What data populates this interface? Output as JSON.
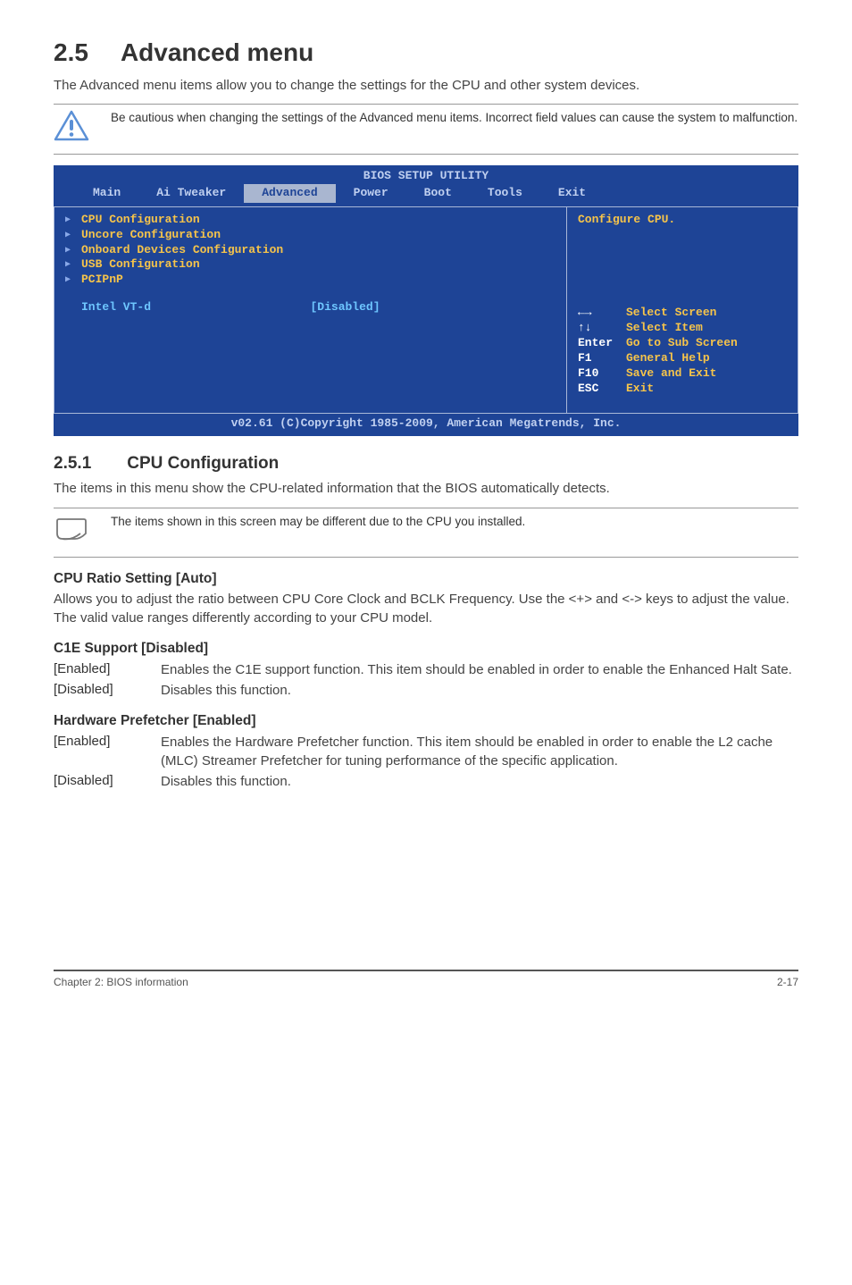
{
  "section": {
    "number": "2.5",
    "title": "Advanced menu"
  },
  "intro": "The Advanced menu items allow you to change the settings for the CPU and other system devices.",
  "warning": "Be cautious when changing the settings of the Advanced menu items. Incorrect field values can cause the system to malfunction.",
  "bios": {
    "header": "BIOS SETUP UTILITY",
    "tabs": [
      "Main",
      "Ai Tweaker",
      "Advanced",
      "Power",
      "Boot",
      "Tools",
      "Exit"
    ],
    "active_tab": "Advanced",
    "menu_items": [
      "CPU Configuration",
      "Uncore Configuration",
      "Onboard Devices Configuration",
      "USB Configuration",
      "PCIPnP"
    ],
    "field_name": "Intel VT-d",
    "field_value": "[Disabled]",
    "help_top": "Configure CPU.",
    "legend": [
      {
        "key": "←→",
        "desc": "Select Screen"
      },
      {
        "key": "↑↓",
        "desc": "Select Item"
      },
      {
        "key": "Enter",
        "desc": "Go to Sub Screen"
      },
      {
        "key": "F1",
        "desc": "General Help"
      },
      {
        "key": "F10",
        "desc": "Save and Exit"
      },
      {
        "key": "ESC",
        "desc": "Exit"
      }
    ],
    "footer": "v02.61 (C)Copyright 1985-2009, American Megatrends, Inc."
  },
  "subsection": {
    "number": "2.5.1",
    "title": "CPU Configuration"
  },
  "subintro": "The items in this menu show the CPU-related information that the BIOS automatically detects.",
  "note": "The items shown in this screen may be different due to the CPU you installed.",
  "cpu_ratio": {
    "heading": "CPU Ratio Setting [Auto]",
    "body": "Allows you to adjust the ratio between CPU Core Clock and BCLK Frequency. Use the <+> and <-> keys to adjust the value. The valid value ranges differently according to your CPU model."
  },
  "c1e": {
    "heading": "C1E Support [Disabled]",
    "enabled_key": "[Enabled]",
    "enabled_val": "Enables the C1E support function. This item should be enabled in order to enable the Enhanced Halt Sate.",
    "disabled_key": "[Disabled]",
    "disabled_val": "Disables this function."
  },
  "hwpf": {
    "heading": "Hardware Prefetcher [Enabled]",
    "enabled_key": "[Enabled]",
    "enabled_val": "Enables the Hardware Prefetcher function. This item should be enabled in order to enable the L2 cache (MLC) Streamer Prefetcher for tuning performance of the specific application.",
    "disabled_key": "[Disabled]",
    "disabled_val": "Disables this function."
  },
  "footer": {
    "left": "Chapter 2: BIOS information",
    "right": "2-17"
  }
}
